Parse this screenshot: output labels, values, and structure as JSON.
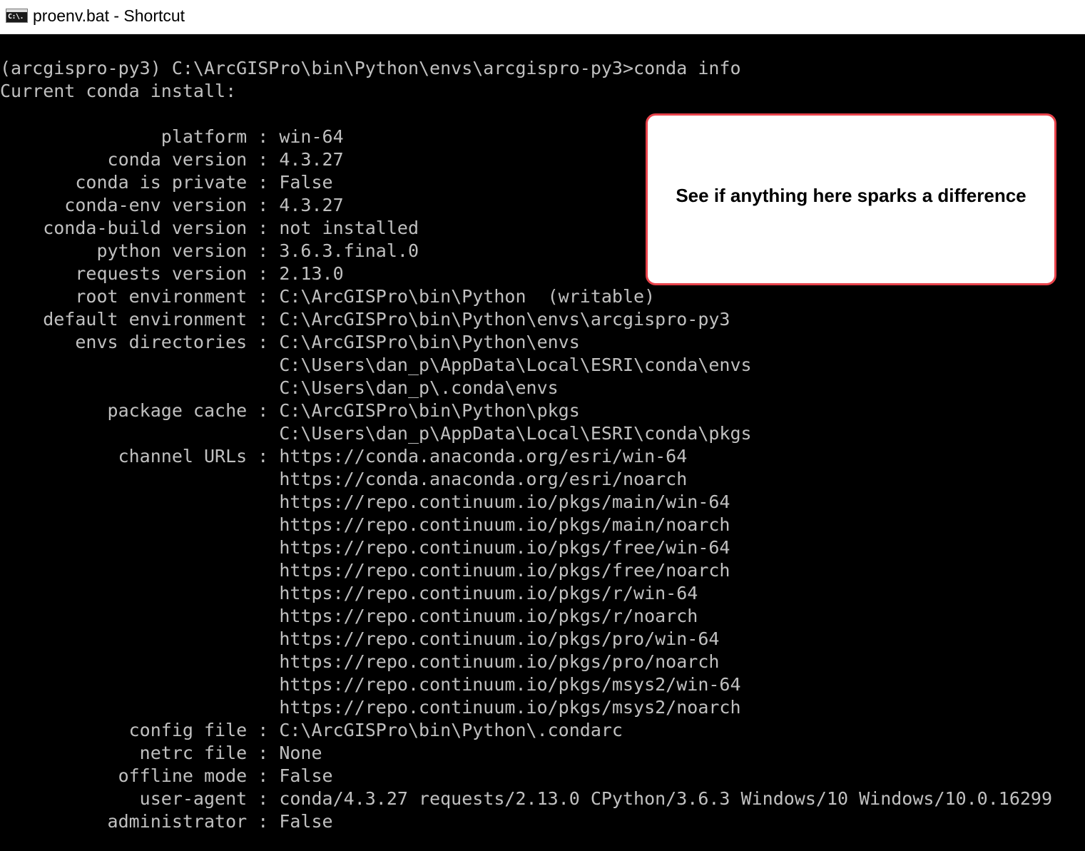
{
  "window": {
    "title": "proenv.bat - Shortcut",
    "icon": "cmd-console-icon",
    "icon_glyph": "C:\\."
  },
  "console": {
    "lines": [
      "(arcgispro-py3) C:\\ArcGISPro\\bin\\Python\\envs\\arcgispro-py3>conda info",
      "Current conda install:",
      "",
      "               platform : win-64",
      "          conda version : 4.3.27",
      "       conda is private : False",
      "      conda-env version : 4.3.27",
      "    conda-build version : not installed",
      "         python version : 3.6.3.final.0",
      "       requests version : 2.13.0",
      "       root environment : C:\\ArcGISPro\\bin\\Python  (writable)",
      "    default environment : C:\\ArcGISPro\\bin\\Python\\envs\\arcgispro-py3",
      "       envs directories : C:\\ArcGISPro\\bin\\Python\\envs",
      "                          C:\\Users\\dan_p\\AppData\\Local\\ESRI\\conda\\envs",
      "                          C:\\Users\\dan_p\\.conda\\envs",
      "          package cache : C:\\ArcGISPro\\bin\\Python\\pkgs",
      "                          C:\\Users\\dan_p\\AppData\\Local\\ESRI\\conda\\pkgs",
      "           channel URLs : https://conda.anaconda.org/esri/win-64",
      "                          https://conda.anaconda.org/esri/noarch",
      "                          https://repo.continuum.io/pkgs/main/win-64",
      "                          https://repo.continuum.io/pkgs/main/noarch",
      "                          https://repo.continuum.io/pkgs/free/win-64",
      "                          https://repo.continuum.io/pkgs/free/noarch",
      "                          https://repo.continuum.io/pkgs/r/win-64",
      "                          https://repo.continuum.io/pkgs/r/noarch",
      "                          https://repo.continuum.io/pkgs/pro/win-64",
      "                          https://repo.continuum.io/pkgs/pro/noarch",
      "                          https://repo.continuum.io/pkgs/msys2/win-64",
      "                          https://repo.continuum.io/pkgs/msys2/noarch",
      "            config file : C:\\ArcGISPro\\bin\\Python\\.condarc",
      "             netrc file : None",
      "           offline mode : False",
      "             user-agent : conda/4.3.27 requests/2.13.0 CPython/3.6.3 Windows/10 Windows/10.0.16299",
      "          administrator : False"
    ]
  },
  "callout": {
    "text": "See if anything here sparks a difference"
  },
  "colors": {
    "console_background": "#000000",
    "console_text": "#c0c0c0",
    "titlebar_background": "#ffffff",
    "callout_border": "#e8434b"
  }
}
